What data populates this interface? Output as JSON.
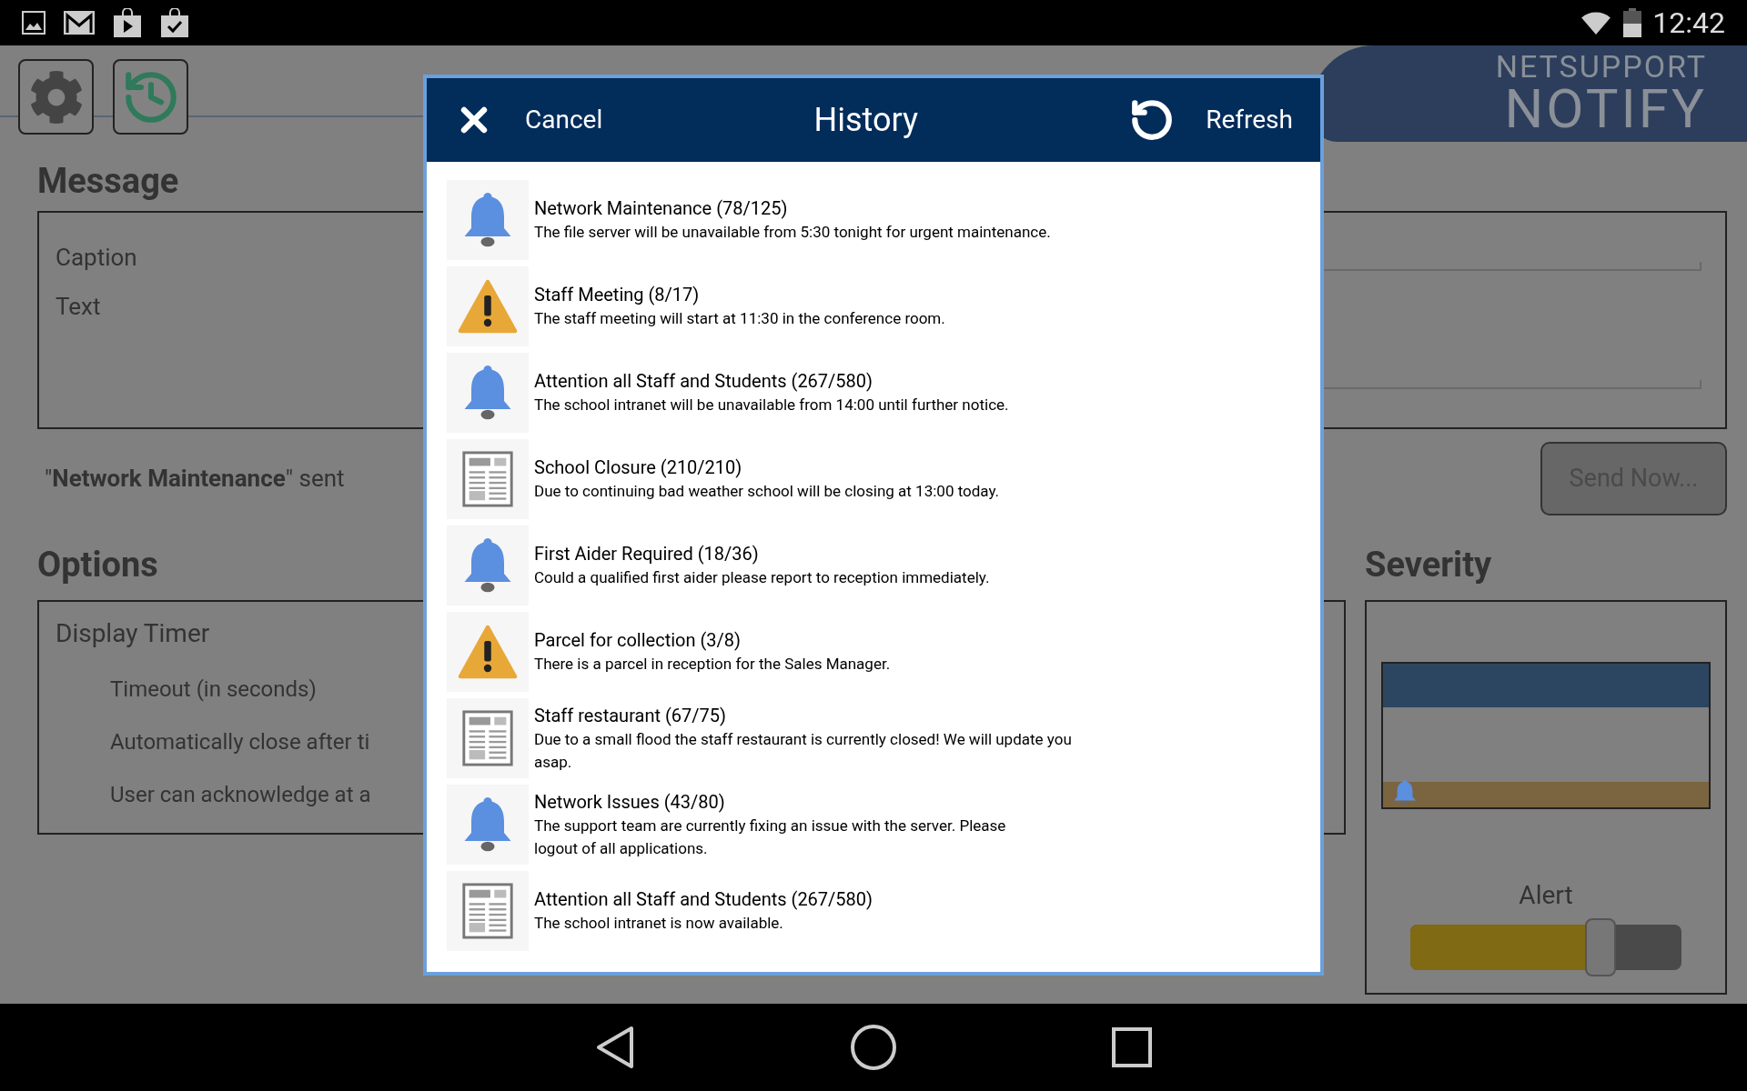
{
  "status_bar": {
    "time": "12:42"
  },
  "logo": {
    "line1": "NETSUPPORT",
    "line2": "NOTIFY"
  },
  "message": {
    "heading": "Message",
    "fields": [
      {
        "label": "Caption"
      },
      {
        "label": "Text"
      }
    ]
  },
  "sent_notice": "\"**Network Maintenance**\" sent",
  "send_button": {
    "label": "Send Now...",
    "disabled": true
  },
  "options": {
    "heading": "Options",
    "group_label": "Display Timer",
    "items": [
      "Timeout (in seconds)",
      "Automatically close after ti",
      "User can acknowledge at a"
    ]
  },
  "severity": {
    "heading": "Severity",
    "level_label": "Alert",
    "level": 0.7
  },
  "dialog": {
    "title": "History",
    "cancel": "Cancel",
    "refresh": "Refresh",
    "items": [
      {
        "kind": "bell",
        "title": "Network Maintenance (78/125)",
        "lines": [
          "The file server will be unavailable from 5:30 tonight for urgent maintenance."
        ]
      },
      {
        "kind": "warning",
        "title": "Staff Meeting (8/17)",
        "lines": [
          "The staff meeting will start at 11:30 in the conference room."
        ]
      },
      {
        "kind": "bell",
        "title": "Attention all Staff and Students (267/580)",
        "lines": [
          "The school intranet will be unavailable from 14:00 until further notice."
        ]
      },
      {
        "kind": "news",
        "title": "School Closure (210/210)",
        "lines": [
          "Due to continuing bad weather school will be closing at 13:00 today."
        ]
      },
      {
        "kind": "bell",
        "title": "First Aider Required (18/36)",
        "lines": [
          "Could a qualified first aider please report to reception immediately."
        ]
      },
      {
        "kind": "warning",
        "title": "Parcel for collection (3/8)",
        "lines": [
          "There is a parcel in reception for the Sales Manager."
        ]
      },
      {
        "kind": "news",
        "title": "Staff restaurant (67/75)",
        "lines": [
          "Due to a small flood the staff restaurant is currently closed! We will update you",
          "asap."
        ]
      },
      {
        "kind": "bell",
        "title": "Network Issues (43/80)",
        "lines": [
          "The support team are currently fixing an issue with the server. Please",
          "logout of all applications."
        ]
      },
      {
        "kind": "news",
        "title": "Attention all Staff and Students (267/580)",
        "lines": [
          "The school intranet is now available."
        ]
      }
    ]
  }
}
